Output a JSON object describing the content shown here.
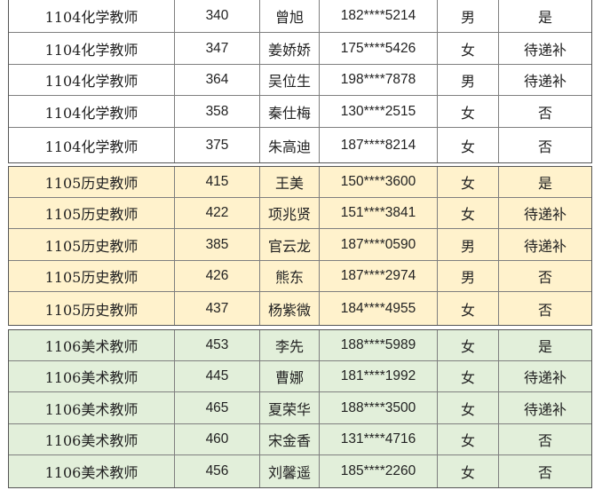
{
  "groups": [
    {
      "rows": [
        {
          "dept": "1104化学教师",
          "score": "340",
          "name": "曾旭",
          "phone": "182****5214",
          "sex": "男",
          "status": "是"
        },
        {
          "dept": "1104化学教师",
          "score": "347",
          "name": "姜娇娇",
          "phone": "175****5426",
          "sex": "女",
          "status": "待递补"
        },
        {
          "dept": "1104化学教师",
          "score": "364",
          "name": "吴位生",
          "phone": "198****7878",
          "sex": "男",
          "status": "待递补"
        },
        {
          "dept": "1104化学教师",
          "score": "358",
          "name": "秦仕梅",
          "phone": "130****2515",
          "sex": "女",
          "status": "否"
        },
        {
          "dept": "1104化学教师",
          "score": "375",
          "name": "朱高迪",
          "phone": "187****8214",
          "sex": "女",
          "status": "否"
        }
      ]
    },
    {
      "rows": [
        {
          "dept": "1105历史教师",
          "score": "415",
          "name": "王美",
          "phone": "150****3600",
          "sex": "女",
          "status": "是"
        },
        {
          "dept": "1105历史教师",
          "score": "422",
          "name": "项兆贤",
          "phone": "151****3841",
          "sex": "女",
          "status": "待递补"
        },
        {
          "dept": "1105历史教师",
          "score": "385",
          "name": "官云龙",
          "phone": "187****0590",
          "sex": "男",
          "status": "待递补"
        },
        {
          "dept": "1105历史教师",
          "score": "426",
          "name": "熊东",
          "phone": "187****2974",
          "sex": "男",
          "status": "否"
        },
        {
          "dept": "1105历史教师",
          "score": "437",
          "name": "杨紫微",
          "phone": "184****4955",
          "sex": "女",
          "status": "否"
        }
      ]
    },
    {
      "rows": [
        {
          "dept": "1106美术教师",
          "score": "453",
          "name": "李先",
          "phone": "188****5989",
          "sex": "女",
          "status": "是"
        },
        {
          "dept": "1106美术教师",
          "score": "445",
          "name": "曹娜",
          "phone": "181****1992",
          "sex": "女",
          "status": "待递补"
        },
        {
          "dept": "1106美术教师",
          "score": "465",
          "name": "夏荣华",
          "phone": "188****3500",
          "sex": "女",
          "status": "待递补"
        },
        {
          "dept": "1106美术教师",
          "score": "460",
          "name": "宋金香",
          "phone": "131****4716",
          "sex": "女",
          "status": "否"
        },
        {
          "dept": "1106美术教师",
          "score": "456",
          "name": "刘馨遥",
          "phone": "185****2260",
          "sex": "女",
          "status": "否"
        }
      ]
    }
  ]
}
